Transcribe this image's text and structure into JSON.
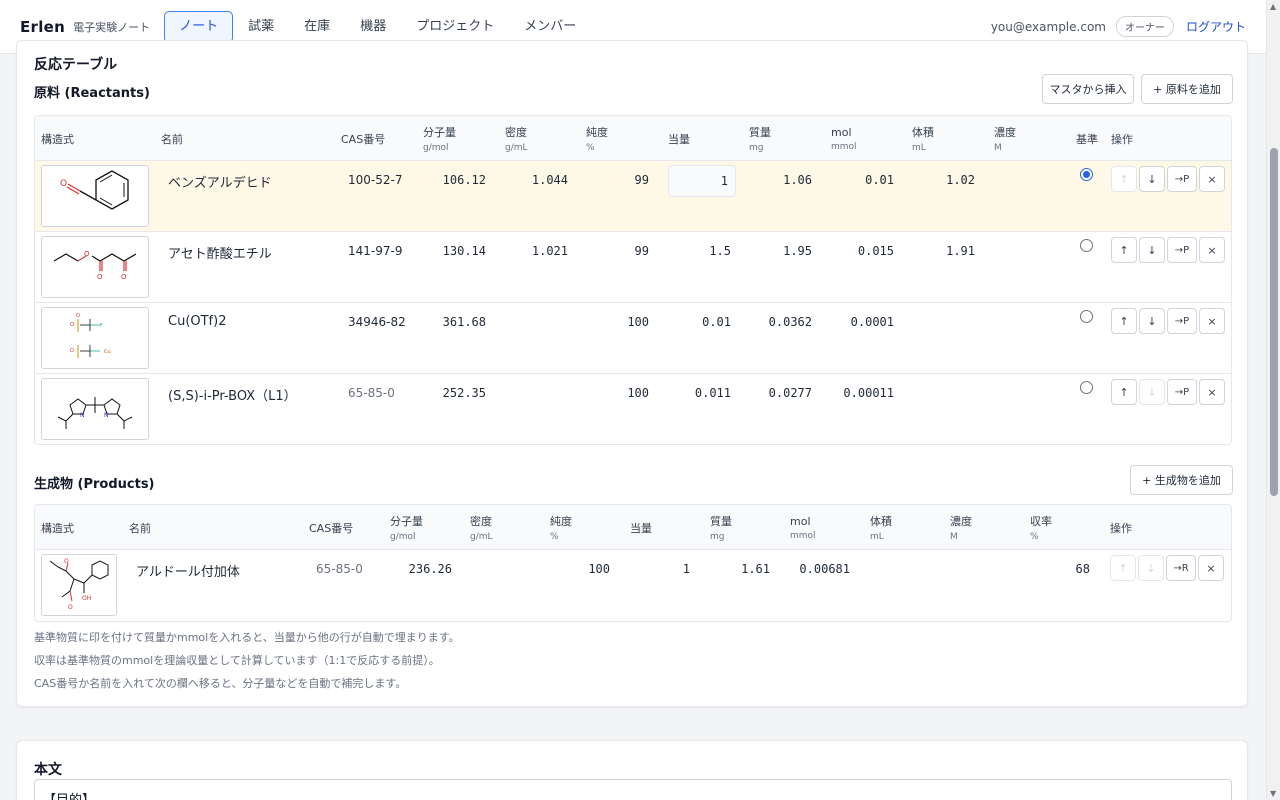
{
  "header": {
    "brand": "Erlen",
    "brand_sub": "電子実験ノート",
    "nav": [
      "ノート",
      "試薬",
      "在庫",
      "機器",
      "プロジェクト",
      "メンバー"
    ],
    "email": "you@example.com",
    "role": "オーナー",
    "logout": "ログアウト"
  },
  "reaction": {
    "section_title": "反応テーブル",
    "reactants_title": "原料 (Reactants)",
    "btn_insert_master": "マスタから挿入",
    "btn_add_reactant": "+ 原料を追加",
    "reactant_headers": {
      "structure": "構造式",
      "name": "名前",
      "cas": "CAS番号",
      "mw": "分子量",
      "mw_unit": "g/mol",
      "density": "密度",
      "density_unit": "g/mL",
      "purity": "純度",
      "purity_unit": "%",
      "equiv": "当量",
      "mass": "質量",
      "mass_unit": "mg",
      "mol": "mol",
      "mol_unit": "mmol",
      "volume": "体積",
      "volume_unit": "mL",
      "conc": "濃度",
      "conc_unit": "M",
      "base": "基準",
      "actions": "操作"
    },
    "reactants": [
      {
        "name": "ベンズアルデヒド",
        "cas": "100-52-7",
        "mw": "106.12",
        "density": "1.044",
        "purity": "99",
        "equiv": "1",
        "mass": "1.06",
        "mol": "0.01",
        "volume": "1.02",
        "conc": ""
      },
      {
        "name": "アセト酢酸エチル",
        "cas": "141-97-9",
        "mw": "130.14",
        "density": "1.021",
        "purity": "99",
        "equiv": "1.5",
        "mass": "1.95",
        "mol": "0.015",
        "volume": "1.91",
        "conc": ""
      },
      {
        "name": "Cu(OTf)2",
        "cas": "34946-82",
        "mw": "361.68",
        "density": "",
        "purity": "100",
        "equiv": "0.01",
        "mass": "0.0362",
        "mol": "0.0001",
        "volume": "",
        "conc": ""
      },
      {
        "name": "(S,S)-i-Pr-BOX（L1）",
        "cas": "65-85-0",
        "mw": "252.35",
        "density": "",
        "purity": "100",
        "equiv": "0.011",
        "mass": "0.0277",
        "mol": "0.00011",
        "volume": "",
        "conc": ""
      }
    ],
    "products_title": "生成物 (Products)",
    "btn_add_product": "+ 生成物を追加",
    "product_headers": {
      "structure": "構造式",
      "name": "名前",
      "cas": "CAS番号",
      "mw": "分子量",
      "mw_unit": "g/mol",
      "density": "密度",
      "density_unit": "g/mL",
      "purity": "純度",
      "purity_unit": "%",
      "equiv": "当量",
      "mass": "質量",
      "mass_unit": "mg",
      "mol": "mol",
      "mol_unit": "mmol",
      "volume": "体積",
      "volume_unit": "mL",
      "conc": "濃度",
      "conc_unit": "M",
      "yield": "収率",
      "yield_unit": "%",
      "actions": "操作"
    },
    "products": [
      {
        "name": "アルドール付加体",
        "cas": "65-85-0",
        "mw": "236.26",
        "purity": "100",
        "equiv": "1",
        "mass": "1.61",
        "mol": "0.00681",
        "yield": "68"
      }
    ],
    "action_labels": {
      "up": "↑",
      "down": "↓",
      "to_product": "→P",
      "to_reactant": "→R",
      "remove": "×"
    },
    "notes": [
      "基準物質に印を付けて質量かmmolを入れると、当量から他の行が自動で埋まります。",
      "収率は基準物質のmmolを理論収量として計算しています（1:1で反応する前提）。",
      "CAS番号か名前を入れて次の欄へ移ると、分子量などを自動で補完します。"
    ]
  },
  "body_section": {
    "title": "本文",
    "content": "【目的】"
  },
  "colors": {
    "accent": "#2563eb",
    "highlight_row": "#fef9e7"
  }
}
